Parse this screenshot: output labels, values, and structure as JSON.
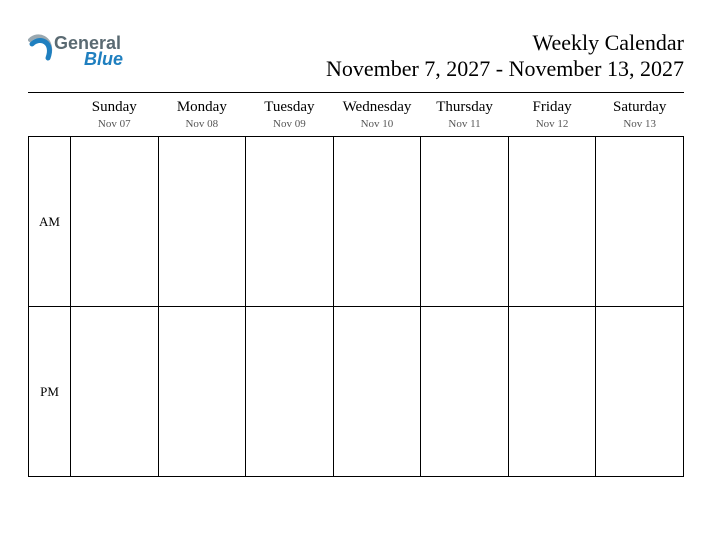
{
  "logo": {
    "text1": "General",
    "text2": "Blue",
    "swoosh_blue": "#1f7fbf",
    "swoosh_gray": "#9aa8b0"
  },
  "header": {
    "title": "Weekly Calendar",
    "range": "November 7, 2027 - November 13, 2027"
  },
  "days": [
    {
      "name": "Sunday",
      "date": "Nov 07"
    },
    {
      "name": "Monday",
      "date": "Nov 08"
    },
    {
      "name": "Tuesday",
      "date": "Nov 09"
    },
    {
      "name": "Wednesday",
      "date": "Nov 10"
    },
    {
      "name": "Thursday",
      "date": "Nov 11"
    },
    {
      "name": "Friday",
      "date": "Nov 12"
    },
    {
      "name": "Saturday",
      "date": "Nov 13"
    }
  ],
  "periods": [
    "AM",
    "PM"
  ]
}
